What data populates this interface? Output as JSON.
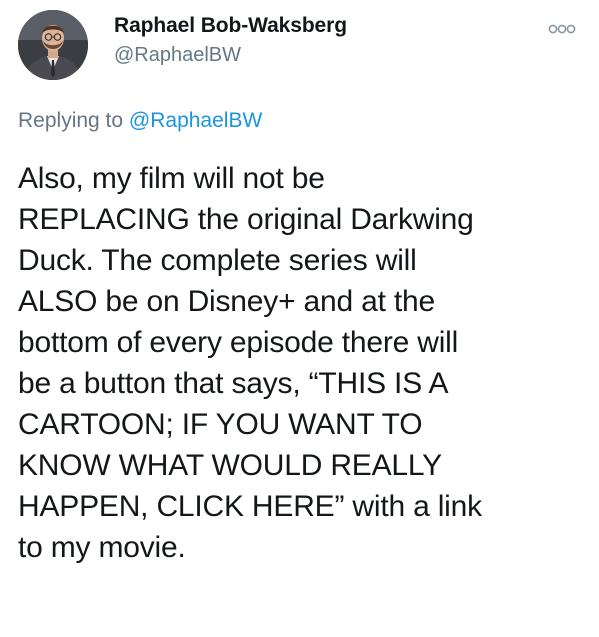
{
  "author": {
    "display_name": "Raphael Bob-Waksberg",
    "handle": "@RaphaelBW"
  },
  "reply_context": {
    "prefix": "Replying to",
    "mention": "@RaphaelBW"
  },
  "tweet": {
    "lines": [
      "Also, my film will not be",
      "REPLACING the original Darkwing",
      "Duck. The complete series will",
      "ALSO be on Disney+ and at the",
      "bottom of every episode there will",
      "be a button that says, “THIS IS A",
      "CARTOON; IF YOU WANT TO",
      "KNOW WHAT WOULD REALLY",
      "HAPPEN, CLICK HERE” with a link",
      "to my movie."
    ]
  },
  "icons": {
    "avatar": "profile-photo",
    "more": "more-options-icon"
  },
  "colors": {
    "text": "#14171a",
    "secondary": "#657786",
    "link": "#1b95e0"
  }
}
